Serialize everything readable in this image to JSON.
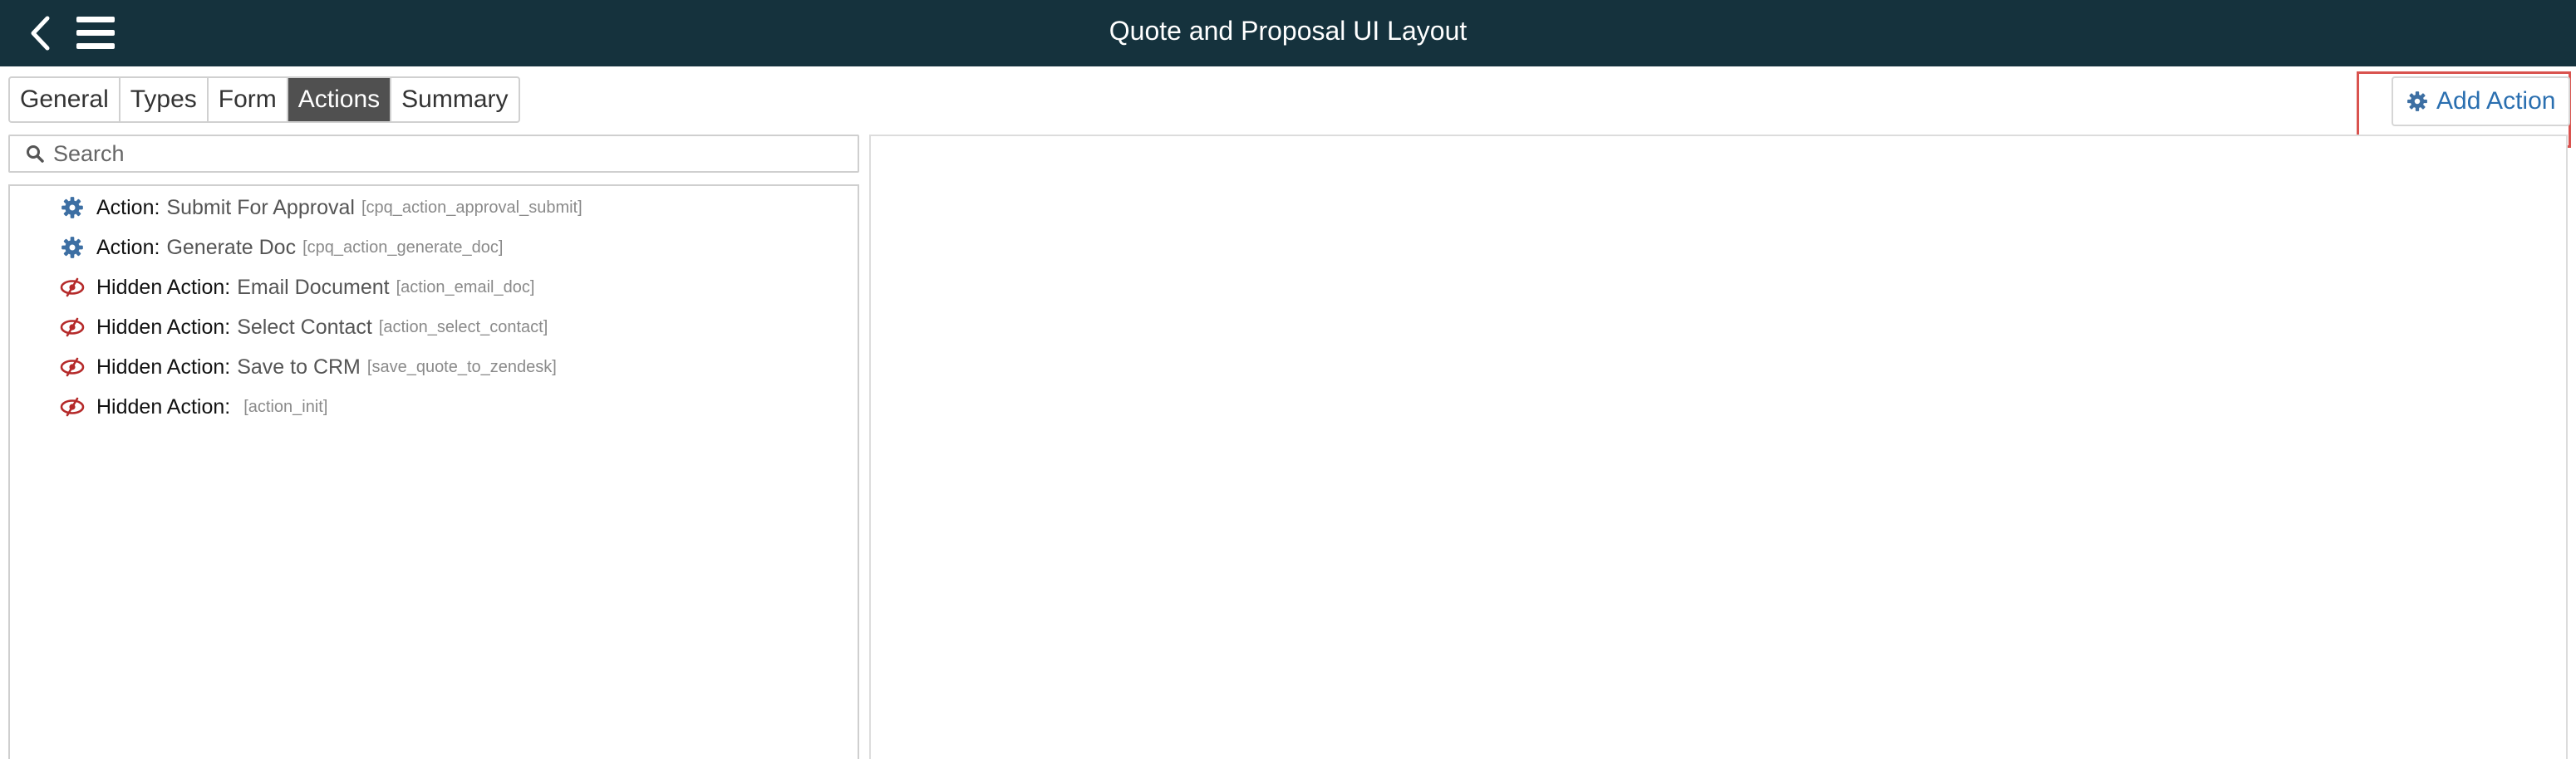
{
  "header": {
    "title": "Quote and Proposal UI Layout",
    "back_icon": "chevron-left-icon",
    "menu_icon": "hamburger-menu-icon"
  },
  "tabs": [
    {
      "label": "General",
      "active": false
    },
    {
      "label": "Types",
      "active": false
    },
    {
      "label": "Form",
      "active": false
    },
    {
      "label": "Actions",
      "active": true
    },
    {
      "label": "Summary",
      "active": false
    }
  ],
  "toolbar": {
    "add_action_label": "Add Action",
    "add_action_icon": "gear-icon"
  },
  "search": {
    "placeholder": "Search",
    "value": ""
  },
  "actions": [
    {
      "prefix": "Action:",
      "name": "Submit For Approval",
      "code": "[cpq_action_approval_submit]",
      "icon": "gear-icon"
    },
    {
      "prefix": "Action:",
      "name": "Generate Doc",
      "code": "[cpq_action_generate_doc]",
      "icon": "gear-icon"
    },
    {
      "prefix": "Hidden Action:",
      "name": "Email Document",
      "code": "[action_email_doc]",
      "icon": "eye-slash-icon"
    },
    {
      "prefix": "Hidden Action:",
      "name": "Select Contact",
      "code": "[action_select_contact]",
      "icon": "eye-slash-icon"
    },
    {
      "prefix": "Hidden Action:",
      "name": "Save to CRM",
      "code": "[save_quote_to_zendesk]",
      "icon": "eye-slash-icon"
    },
    {
      "prefix": "Hidden Action:",
      "name": "",
      "code": "[action_init]",
      "icon": "eye-slash-icon"
    }
  ],
  "colors": {
    "header_bg": "#15323d",
    "active_tab_bg": "#505050",
    "accent_blue": "#2a6fb0",
    "gear_icon": "#3d6fa3",
    "hidden_icon": "#b52a2a",
    "highlight_border": "#d9534f"
  }
}
